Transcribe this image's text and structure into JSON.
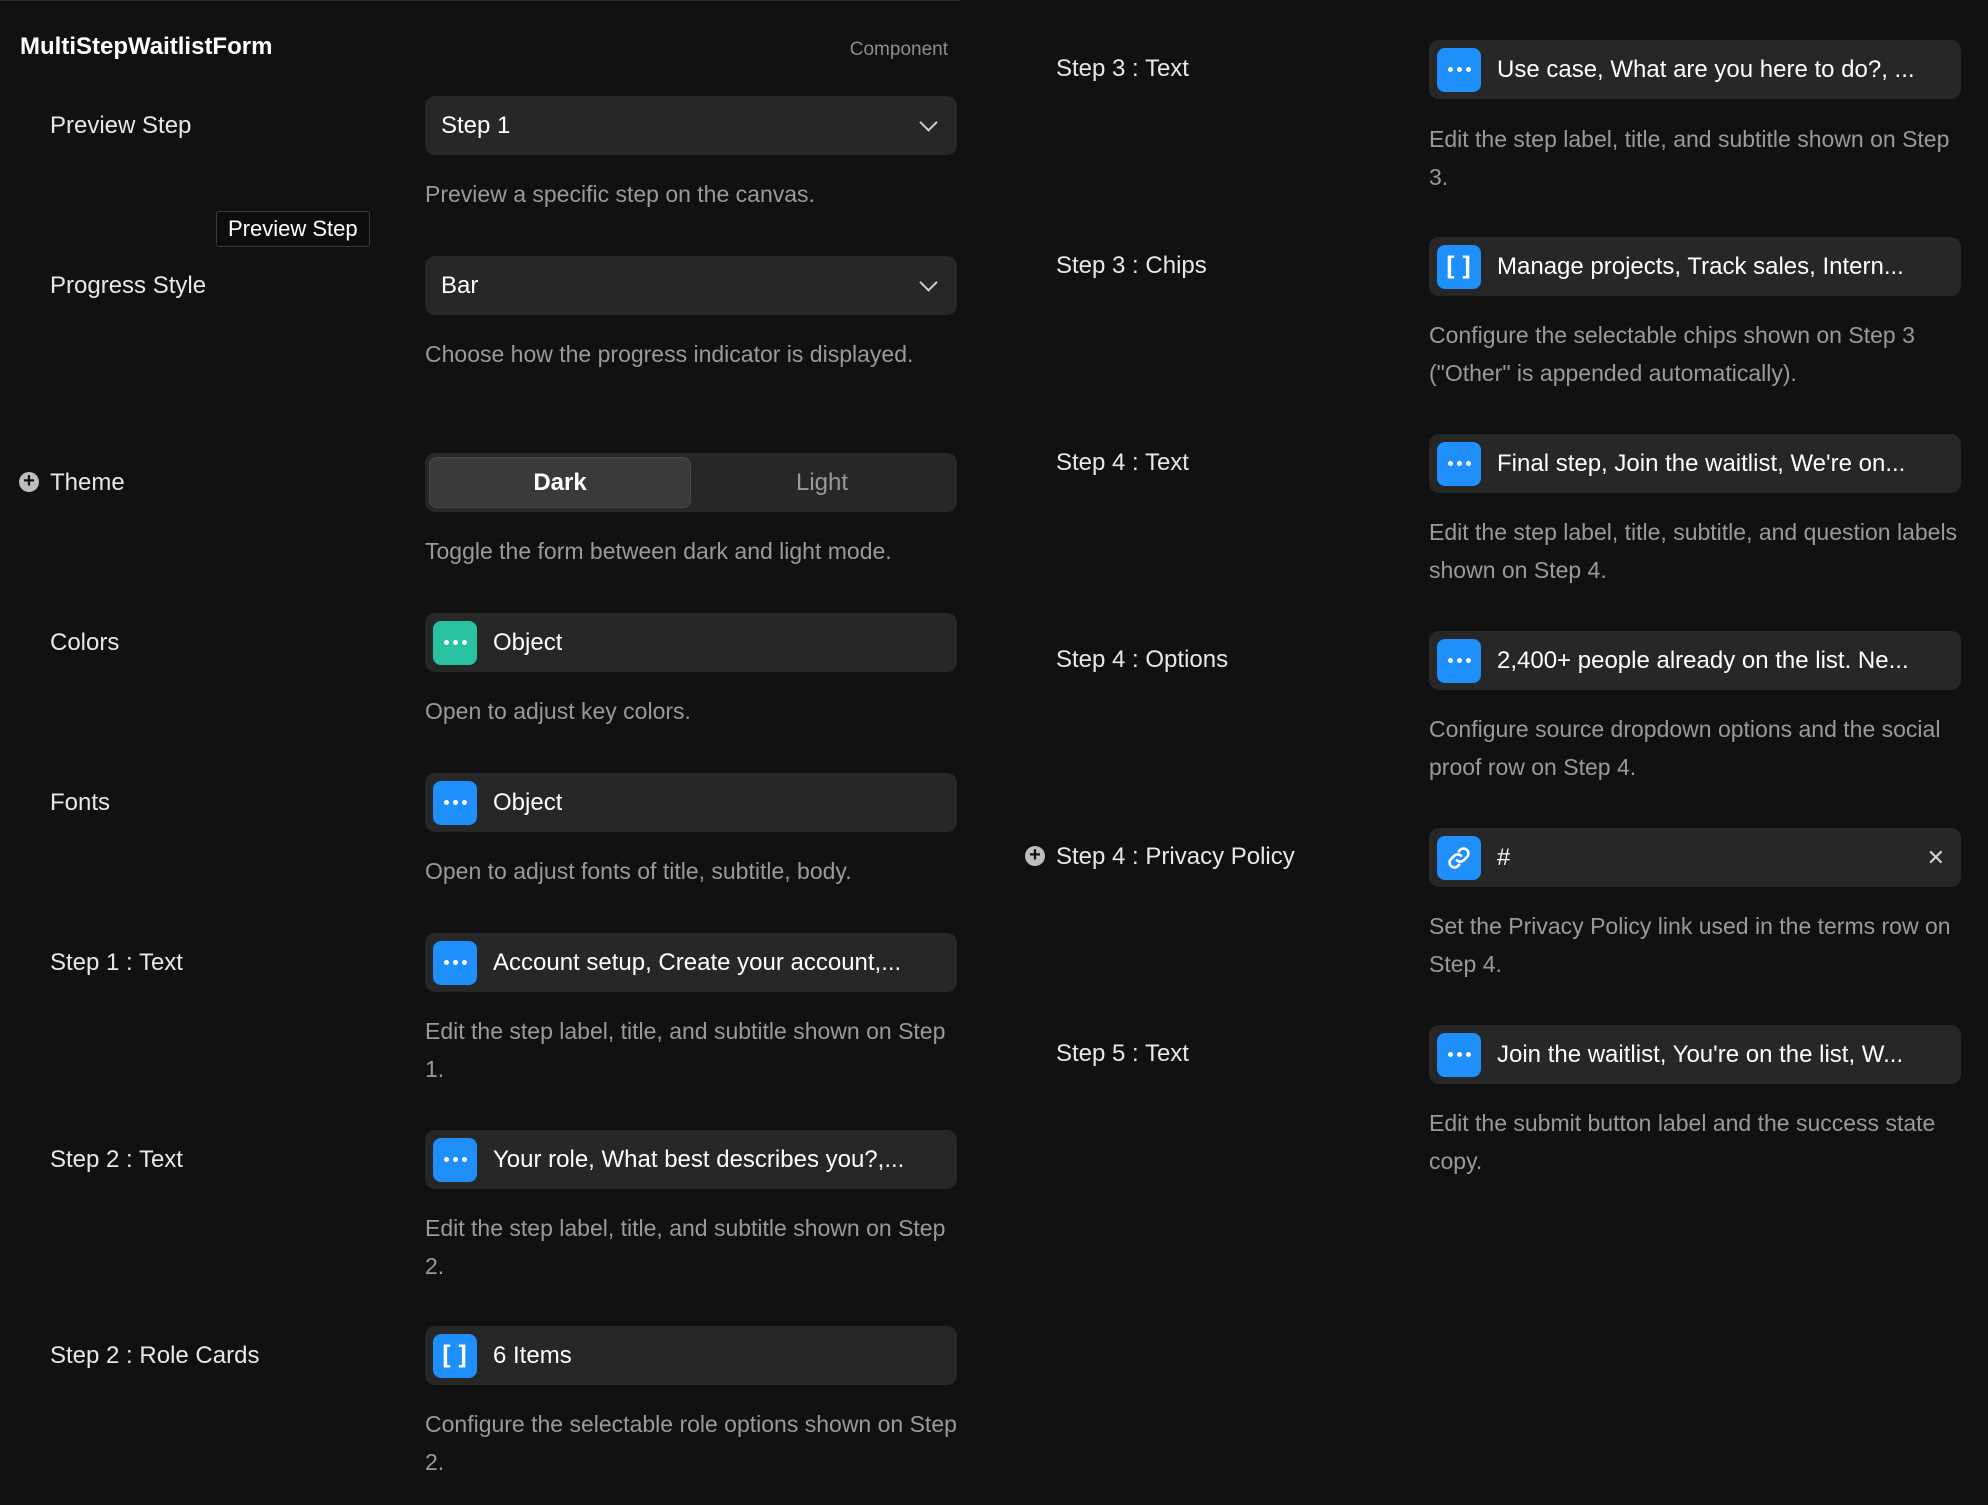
{
  "header": {
    "title": "MultiStepWaitlistForm",
    "tag": "Component"
  },
  "tooltip": "Preview Step",
  "left": {
    "preview_step": {
      "label": "Preview Step",
      "value": "Step 1",
      "desc": "Preview a specific step on the canvas."
    },
    "progress_style": {
      "label": "Progress Style",
      "value": "Bar",
      "desc": "Choose how the progress indicator is displayed."
    },
    "theme": {
      "label": "Theme",
      "options": [
        "Dark",
        "Light"
      ],
      "selected": "Dark",
      "desc": "Toggle the form between dark and light mode."
    },
    "colors": {
      "label": "Colors",
      "value": "Object",
      "desc": "Open to adjust key colors."
    },
    "fonts": {
      "label": "Fonts",
      "value": "Object",
      "desc": "Open to adjust fonts of title, subtitle, body."
    },
    "step1_text": {
      "label": "Step 1 : Text",
      "value": "Account setup, Create your account,...",
      "desc": "Edit the step label, title, and subtitle shown on Step 1."
    },
    "step2_text": {
      "label": "Step 2 : Text",
      "value": "Your role, What best describes you?,...",
      "desc": "Edit the step label, title, and subtitle shown on Step 2."
    },
    "step2_cards": {
      "label": "Step 2 : Role Cards",
      "value": "6 Items",
      "desc": "Configure the selectable role options shown on Step 2."
    }
  },
  "right": {
    "step3_text": {
      "label": "Step 3 : Text",
      "value": "Use case, What are you here to do?, ...",
      "desc": "Edit the step label, title, and subtitle shown on Step 3."
    },
    "step3_chips": {
      "label": "Step 3 : Chips",
      "value": "Manage projects, Track sales, Intern...",
      "desc": "Configure the selectable chips shown on Step 3 (\"Other\" is appended automatically)."
    },
    "step4_text": {
      "label": "Step 4 : Text",
      "value": "Final step, Join the waitlist, We're on...",
      "desc": "Edit the step label, title, subtitle, and question labels shown on Step 4."
    },
    "step4_options": {
      "label": "Step 4 : Options",
      "value": "2,400+ people already on the list. Ne...",
      "desc": "Configure source dropdown options and the social proof row on Step 4."
    },
    "step4_privacy": {
      "label": "Step 4 : Privacy Policy",
      "value": "#",
      "desc": "Set the Privacy Policy link used in the terms row on Step 4."
    },
    "step5_text": {
      "label": "Step 5 : Text",
      "value": "Join the waitlist, You're on the list, W...",
      "desc": "Edit the submit button label and the success state copy."
    }
  },
  "icons": {
    "object": "ellipsis-icon",
    "array": "brackets-icon",
    "link": "link-icon",
    "add": "plus-circle-icon",
    "clear": "close-icon",
    "dropdown": "chevron-down-icon"
  },
  "colors": {
    "background": "#111111",
    "control": "#272727",
    "accent_blue": "#1f8ffb",
    "accent_teal": "#29c2a0"
  }
}
